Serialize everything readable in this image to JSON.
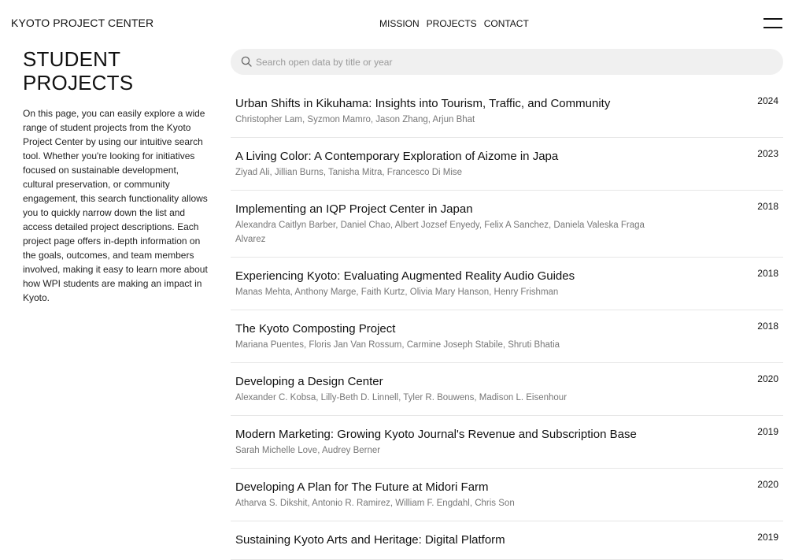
{
  "header": {
    "brand": "KYOTO PROJECT CENTER",
    "nav": [
      "MISSION",
      "PROJECTS",
      "CONTACT"
    ],
    "menu_icon": "hamburger-menu-icon"
  },
  "sidebar": {
    "title_line1": "STUDENT",
    "title_line2": "PROJECTS",
    "intro": "On this page, you can easily explore a wide range of student projects from the Kyoto Project Center by using our intuitive search tool. Whether you're looking for initiatives focused on sustainable development, cultural preservation, or community engagement, this search functionality allows you to quickly narrow down the list and access detailed project descriptions. Each project page offers in-depth information on the goals, outcomes, and team members involved, making it easy to learn more about how WPI students are making an impact in Kyoto."
  },
  "search": {
    "placeholder": "Search open data by title or year",
    "value": "",
    "icon": "search-icon"
  },
  "projects": [
    {
      "title": "Urban Shifts in Kikuhama: Insights into Tourism, Traffic, and Community",
      "authors": "Christopher Lam, Syzmon Mamro, Jason Zhang, Arjun Bhat",
      "year": "2024"
    },
    {
      "title": "A Living Color: A Contemporary Exploration of Aizome in Japa",
      "authors": "Ziyad Ali, Jillian Burns, Tanisha Mitra, Francesco Di Mise",
      "year": "2023"
    },
    {
      "title": "Implementing an IQP Project Center in Japan",
      "authors": "Alexandra Caitlyn Barber, Daniel Chao, Albert Jozsef Enyedy, Felix A Sanchez, Daniela Valeska Fraga Alvarez",
      "year": "2018"
    },
    {
      "title": "Experiencing Kyoto: Evaluating Augmented Reality Audio Guides",
      "authors": "Manas Mehta, Anthony Marge, Faith Kurtz, Olivia Mary Hanson, Henry Frishman",
      "year": "2018"
    },
    {
      "title": "The Kyoto Composting Project",
      "authors": "Mariana Puentes, Floris Jan Van Rossum, Carmine Joseph Stabile, Shruti Bhatia",
      "year": "2018"
    },
    {
      "title": "Developing a Design Center",
      "authors": "Alexander C. Kobsa, Lilly-Beth D. Linnell, Tyler R. Bouwens, Madison L. Eisenhour",
      "year": "2020"
    },
    {
      "title": "Modern Marketing: Growing Kyoto Journal's Revenue and Subscription Base",
      "authors": "Sarah Michelle Love, Audrey Berner",
      "year": "2019"
    },
    {
      "title": "Developing A Plan for The Future at Midori Farm",
      "authors": "Atharva S. Dikshit, Antonio R. Ramirez, William F. Engdahl, Chris Son",
      "year": "2020"
    },
    {
      "title": "Sustaining Kyoto Arts and Heritage: Digital Platform",
      "authors": "",
      "year": "2019"
    }
  ]
}
